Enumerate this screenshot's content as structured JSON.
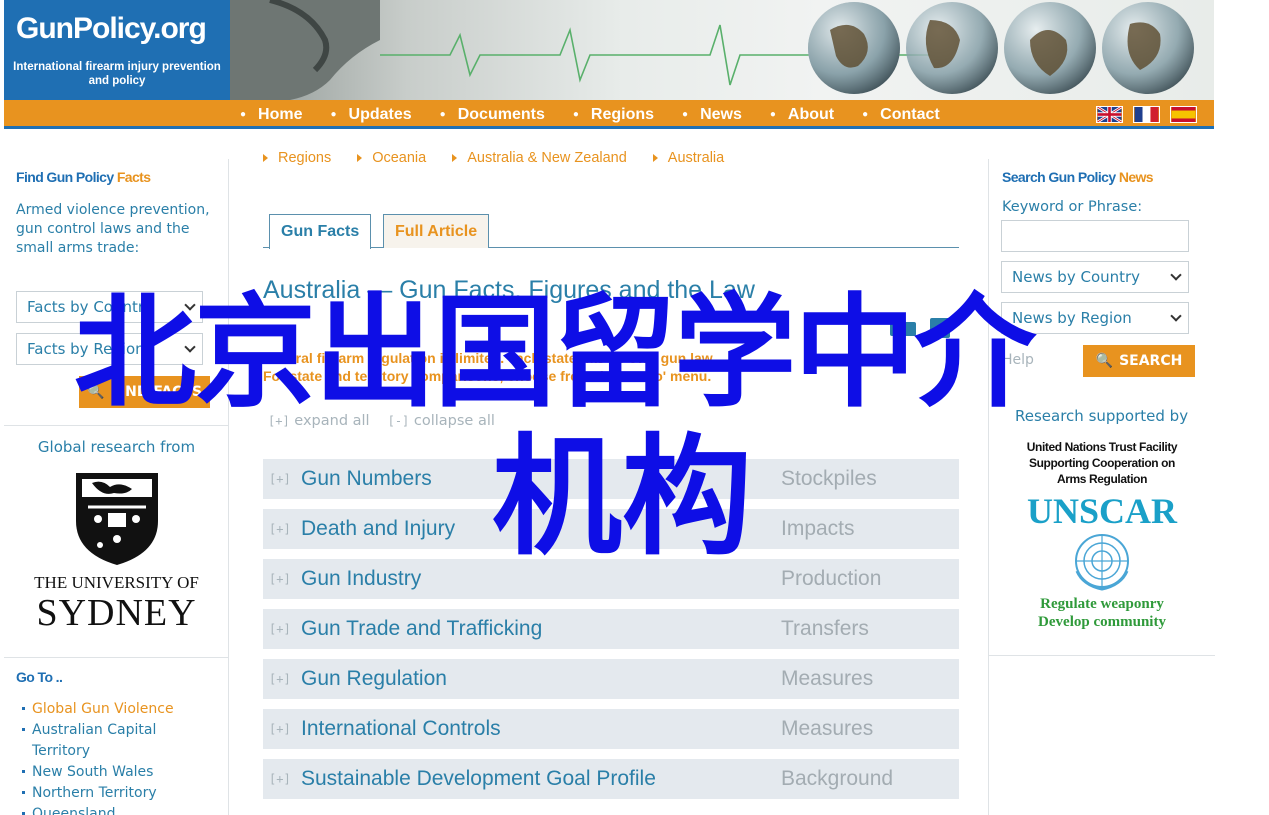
{
  "header": {
    "logo_title": "GunPolicy.org",
    "logo_subtitle": "International firearm injury prevention and policy"
  },
  "nav": {
    "items": [
      "Home",
      "Updates",
      "Documents",
      "Regions",
      "News",
      "About",
      "Contact"
    ],
    "flags": [
      "uk-flag",
      "france-flag",
      "spain-flag"
    ]
  },
  "left": {
    "facts_heading_main": "Find Gun Policy",
    "facts_heading_accent": "Facts",
    "facts_description": "Armed violence prevention, gun control laws and the small arms trade:",
    "facts_by_country": "Facts by Country",
    "facts_by_region": "Facts by Region",
    "find_facts_button": "FIND FACTS",
    "research_from": "Global research from",
    "university_line1": "THE UNIVERSITY OF",
    "university_line2": "SYDNEY",
    "goto_heading": "Go To ..",
    "goto_items": [
      "Global Gun Violence",
      "Australian Capital Territory",
      "New South Wales",
      "Northern Territory",
      "Queensland"
    ]
  },
  "right": {
    "news_heading_main": "Search Gun Policy",
    "news_heading_accent": "News",
    "keyword_label": "Keyword or Phrase:",
    "keyword_value": "",
    "news_by_country": "News by Country",
    "news_by_region": "News by Region",
    "help_text": "Help",
    "search_button": "SEARCH",
    "research_supported": "Research supported by",
    "unscar_line1": "United Nations Trust Facility",
    "unscar_line2": "Supporting Cooperation on",
    "unscar_line3": "Arms Regulation",
    "unscar_title": "UNSCAR",
    "unscar_motto1": "Regulate weaponry",
    "unscar_motto2": "Develop community"
  },
  "content": {
    "breadcrumb": [
      "Regions",
      "Oceania",
      "Australia & New Zealand",
      "Australia"
    ],
    "tabs": [
      "Gun Facts",
      "Full Article"
    ],
    "title": "Australia — Gun Facts, Figures and the Law",
    "intro_line1": "Federal firearm regulation is limited. each state has its own gun law.",
    "intro_line2": "For state and territory comparisons, choose from the 'Go To' menu.",
    "expand_all": "expand all",
    "collapse_all": "collapse all",
    "expand_glyph": "[+]",
    "collapse_glyph": "[-]",
    "topics": [
      {
        "name": "Gun Numbers",
        "tag": "Stockpiles"
      },
      {
        "name": "Death and Injury",
        "tag": "Impacts"
      },
      {
        "name": "Gun Industry",
        "tag": "Production"
      },
      {
        "name": "Gun Trade and Trafficking",
        "tag": "Transfers"
      },
      {
        "name": "Gun Regulation",
        "tag": "Measures"
      },
      {
        "name": "International Controls",
        "tag": "Measures"
      },
      {
        "name": "Sustainable Development Goal Profile",
        "tag": "Background"
      }
    ]
  },
  "overlay": {
    "line1": "北京出国留学中介",
    "line2": "机构",
    "color": "#0e0ee6"
  },
  "colors": {
    "brand_blue": "#1f6fb3",
    "accent_orange": "#e8931f",
    "text_blue": "#2a7fa8",
    "row_bg": "#e4e9ee"
  }
}
